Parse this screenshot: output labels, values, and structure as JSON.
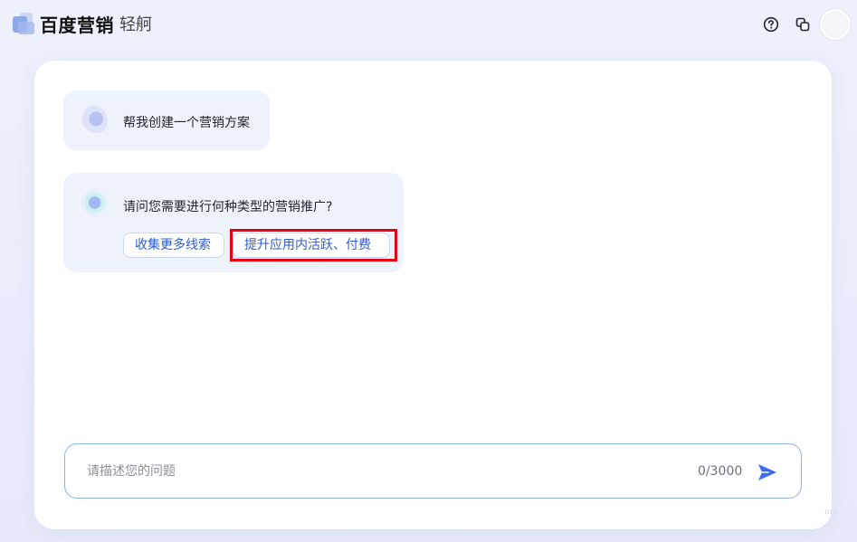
{
  "header": {
    "brand": "百度营销",
    "product": "轻舸",
    "icons": [
      "help-icon",
      "copy-icon"
    ]
  },
  "conversation": {
    "user_message": "帮我创建一个营销方案",
    "bot_message": "请问您需要进行何种类型的营销推广?",
    "options": [
      {
        "label": "收集更多线索"
      },
      {
        "label": "提升应用内活跃、付费"
      }
    ],
    "highlight_color": "#e60012"
  },
  "input": {
    "placeholder": "请描述您的问题",
    "value": "",
    "counter": "0/3000"
  },
  "colors": {
    "accent": "#2f5bd8",
    "send": "#3b6cf0",
    "bubble_bg": "#eef2fb"
  },
  "watermark": "net"
}
